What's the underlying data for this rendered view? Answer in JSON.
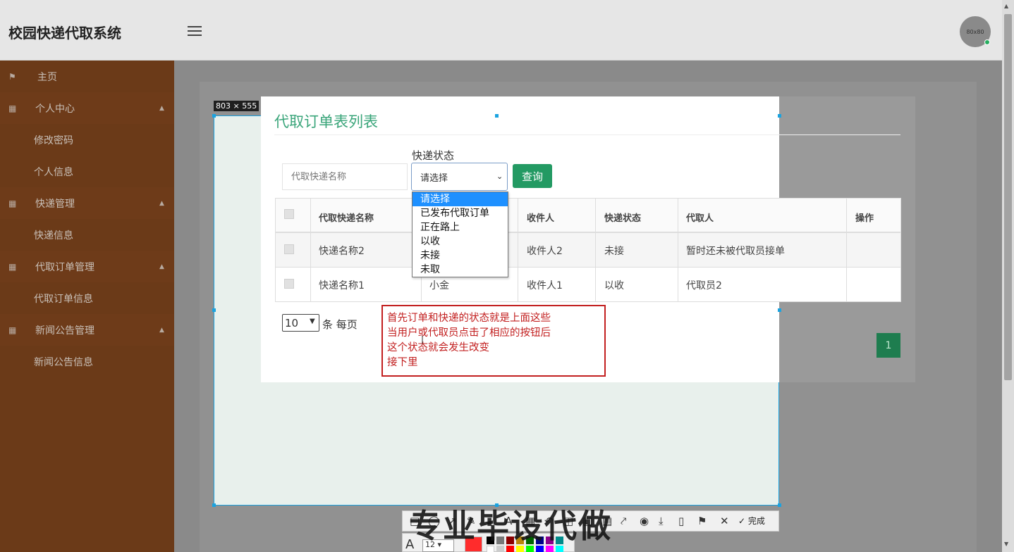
{
  "app": {
    "title": "校园快递代取系统",
    "avatar_text": "80x80"
  },
  "sidebar": {
    "home": "主页",
    "groups": [
      {
        "label": "个人中心",
        "items": [
          "修改密码",
          "个人信息"
        ]
      },
      {
        "label": "快递管理",
        "items": [
          "快递信息"
        ]
      },
      {
        "label": "代取订单管理",
        "items": [
          "代取订单信息"
        ]
      },
      {
        "label": "新闻公告管理",
        "items": [
          "新闻公告信息"
        ]
      }
    ]
  },
  "main": {
    "title": "代取订单表列表",
    "search": {
      "placeholder": "代取快递名称"
    },
    "status_filter": {
      "label": "快递状态",
      "selected": "请选择",
      "options": [
        "请选择",
        "已发布代取订单",
        "正在路上",
        "以收",
        "未接",
        "未取"
      ]
    },
    "query_button": "查询",
    "table": {
      "headers": [
        "代取快递名称",
        "",
        "收件人",
        "快递状态",
        "代取人",
        "操作"
      ],
      "rows": [
        {
          "name": "快递名称2",
          "col2": "",
          "recipient": "收件人2",
          "status": "未接",
          "courier": "暂时还未被代取员接单"
        },
        {
          "name": "快递名称1",
          "col2": "小金",
          "recipient": "收件人1",
          "status": "以收",
          "courier": "代取员2"
        }
      ]
    },
    "pagination": {
      "per_page": "10",
      "per_page_label": "条 每页",
      "current_page": "1"
    }
  },
  "capture": {
    "size_label": "803 × 555",
    "annotation_lines": [
      "首先订单和快递的状态就是上面这些",
      "当用户或代取员点击了相应的按钮后",
      "这个状态就会发生改变",
      "接下里"
    ],
    "toolbar_done": "完成",
    "font_size": "12",
    "watermark": "专业毕设代做",
    "current_color": "#ff2c2c"
  }
}
